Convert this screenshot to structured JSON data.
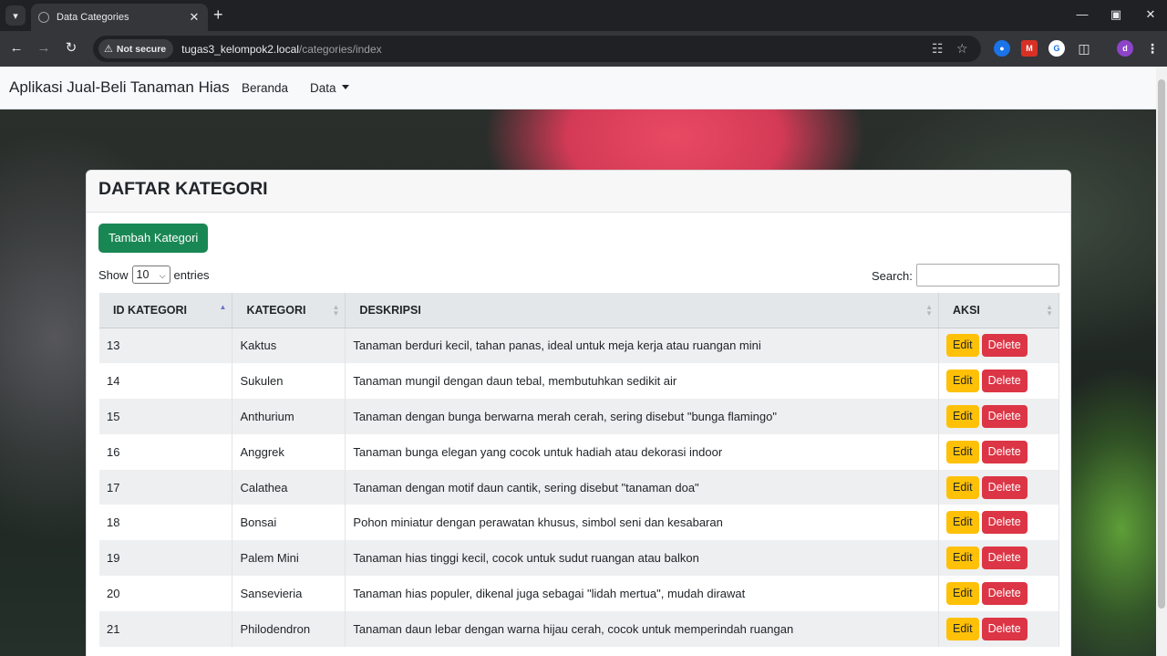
{
  "browser": {
    "tab_title": "Data Categories",
    "security_label": "Not secure",
    "url_host": "tugas3_kelompok2.local",
    "url_path": "/categories/index",
    "profile_initial": "d"
  },
  "navbar": {
    "brand": "Aplikasi Jual-Beli Tanaman Hias",
    "links": [
      "Beranda",
      "Data"
    ]
  },
  "card": {
    "title": "DAFTAR KATEGORI",
    "add_button": "Tambah Kategori",
    "show_label": "Show",
    "entries_value": "10",
    "entries_label": "entries",
    "search_label": "Search:",
    "search_value": ""
  },
  "table": {
    "columns": [
      "ID KATEGORI",
      "KATEGORI",
      "DESKRIPSI",
      "AKSI"
    ],
    "edit_label": "Edit",
    "delete_label": "Delete",
    "rows": [
      {
        "id": "13",
        "kategori": "Kaktus",
        "deskripsi": "Tanaman berduri kecil, tahan panas, ideal untuk meja kerja atau ruangan mini"
      },
      {
        "id": "14",
        "kategori": "Sukulen",
        "deskripsi": "Tanaman mungil dengan daun tebal, membutuhkan sedikit air"
      },
      {
        "id": "15",
        "kategori": "Anthurium",
        "deskripsi": "Tanaman dengan bunga berwarna merah cerah, sering disebut \"bunga flamingo\""
      },
      {
        "id": "16",
        "kategori": "Anggrek",
        "deskripsi": "Tanaman bunga elegan yang cocok untuk hadiah atau dekorasi indoor"
      },
      {
        "id": "17",
        "kategori": "Calathea",
        "deskripsi": "Tanaman dengan motif daun cantik, sering disebut \"tanaman doa\""
      },
      {
        "id": "18",
        "kategori": "Bonsai",
        "deskripsi": "Pohon miniatur dengan perawatan khusus, simbol seni dan kesabaran"
      },
      {
        "id": "19",
        "kategori": "Palem Mini",
        "deskripsi": "Tanaman hias tinggi kecil, cocok untuk sudut ruangan atau balkon"
      },
      {
        "id": "20",
        "kategori": "Sansevieria",
        "deskripsi": "Tanaman hias populer, dikenal juga sebagai \"lidah mertua\", mudah dirawat"
      },
      {
        "id": "21",
        "kategori": "Philodendron",
        "deskripsi": "Tanaman daun lebar dengan warna hijau cerah, cocok untuk memperindah ruangan"
      }
    ]
  },
  "colors": {
    "add_button": "#198754",
    "edit_button": "#ffc107",
    "delete_button": "#dc3545"
  }
}
